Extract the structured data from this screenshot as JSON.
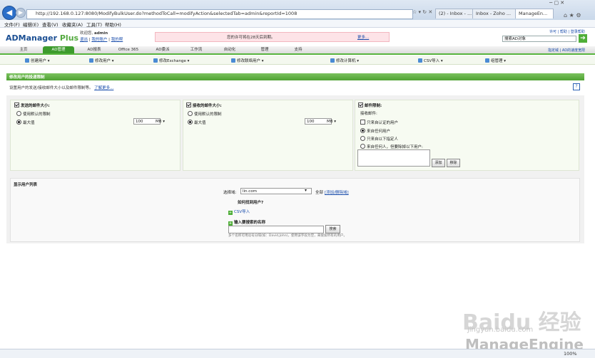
{
  "browser": {
    "url": "http://192.168.0.127:8080/ModifyBulkUser.do?methodToCall=modifyAction&selectedTab=admin&reportId=1008",
    "tabs": [
      "(2) - Inbox - ...",
      "Inbox - Zoho ...",
      "ManageEn..."
    ],
    "menu": [
      "文件(F)",
      "编辑(E)",
      "查看(V)",
      "收藏夹(A)",
      "工具(T)",
      "帮助(H)"
    ],
    "zoom": "100%"
  },
  "header": {
    "logo_main": "ADManager",
    "logo_plus": "Plus",
    "welcome_label": "欢迎您,",
    "welcome_user": "admin",
    "links": [
      "退出",
      "我的账户",
      "我的帮"
    ],
    "license_msg": "您的许可将在28天后到期。",
    "license_more": "更多...",
    "top_links": "许可 | 帮助 | 登录帮助",
    "search_placeholder": "搜索AD对象"
  },
  "nav": {
    "tabs": [
      "主页",
      "AD管理",
      "AD报表",
      "Office 365",
      "AD委派",
      "工作流",
      "自动化",
      "管理",
      "支持"
    ],
    "right_links": "指定域 | AD的速度宽限",
    "sub_items": [
      "创建用户 ▾",
      "修改用户 ▾",
      "修改Exchange ▾",
      "修改联络用户 ▾",
      "修改计算机 ▾",
      "CSV导入 ▾",
      "组管理 ▾"
    ]
  },
  "page": {
    "title": "修改用户的投递限制",
    "desc": "设置用户的发送/接收邮件大小以及邮件限制等。",
    "desc_link": "了解更多...",
    "help": "?"
  },
  "send_panel": {
    "title": "发送的邮件大小:",
    "opt_default": "使用默认的限制",
    "opt_max": "最大值",
    "value": "100",
    "unit": "MB"
  },
  "receive_panel": {
    "title": "接收的邮件大小:",
    "opt_default": "使用默认的限制",
    "opt_max": "最大值",
    "value": "100",
    "unit": "MB"
  },
  "restrict_panel": {
    "title": "邮件限制:",
    "subtitle": "接收邮件:",
    "chk_auth": "只来自认证的用户",
    "opt_all": "来自任何用户",
    "opt_only": "只来自以下指定人",
    "opt_except": "来自任何人，但要除掉以下用户:",
    "btn_add": "添加",
    "btn_remove": "移除"
  },
  "user_list": {
    "title": "显示用户列表",
    "domain_label": "选择域:",
    "domain_value": "lin.com",
    "all_label": "全部",
    "add_domain": "[添加/删除域]",
    "how_title": "如何找到用户?",
    "csv_label": "CSV导入",
    "name_label": "输入要搜索的名称",
    "search_btn": "搜索",
    "hint": "多个名称可用逗号分隔(如：David,John)，使用该字段为空，来搜索所有的用户。"
  },
  "watermark": {
    "baidu": "Baidu 经验",
    "url": "jingyan.baidu.com",
    "me": "ManageEngine"
  }
}
